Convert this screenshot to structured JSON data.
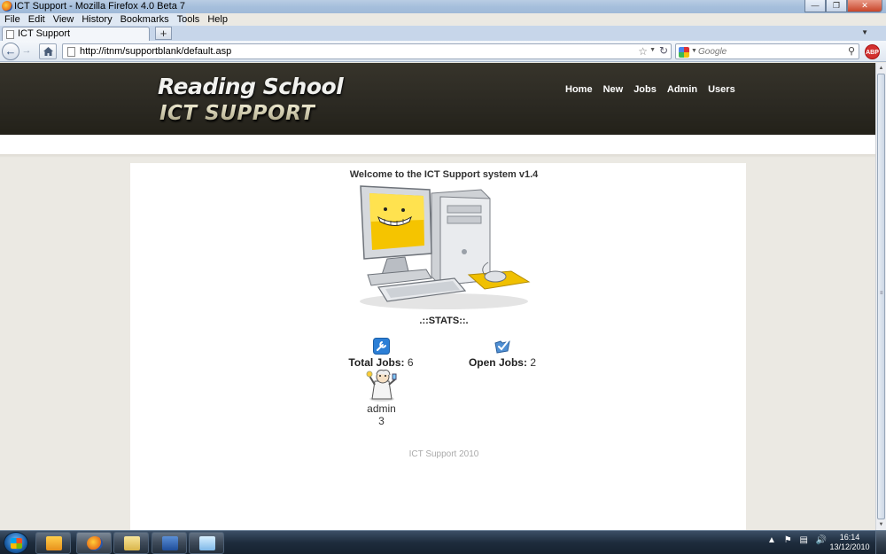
{
  "window": {
    "title": "ICT Support - Mozilla Firefox 4.0 Beta 7"
  },
  "menu": {
    "items": [
      "File",
      "Edit",
      "View",
      "History",
      "Bookmarks",
      "Tools",
      "Help"
    ]
  },
  "tabs": [
    {
      "label": "ICT Support"
    }
  ],
  "navbar": {
    "url": "http://itnm/supportblank/default.asp",
    "search_placeholder": "Google"
  },
  "site": {
    "logo_line1": "Reading School",
    "logo_line2": "ICT SUPPORT",
    "nav": [
      "Home",
      "New",
      "Jobs",
      "Admin",
      "Users"
    ]
  },
  "content": {
    "welcome": "Welcome to the ICT Support system v1.4",
    "stats_heading": ".::STATS::.",
    "total_jobs_label": "Total Jobs:",
    "total_jobs_value": "6",
    "open_jobs_label": "Open Jobs:",
    "open_jobs_value": "2",
    "user_name": "admin",
    "user_count": "3",
    "footer": "ICT Support 2010"
  },
  "taskbar": {
    "time": "16:14",
    "date": "13/12/2010",
    "apps": [
      "outlook-icon",
      "firefox-icon",
      "explorer-icon",
      "remote-desktop-icon",
      "notes-icon"
    ]
  },
  "colors": {
    "header_bg": "#2b2922",
    "nav_text": "#ffffff",
    "page_bg": "#ebe9e3",
    "content_bg": "#ffffff"
  }
}
